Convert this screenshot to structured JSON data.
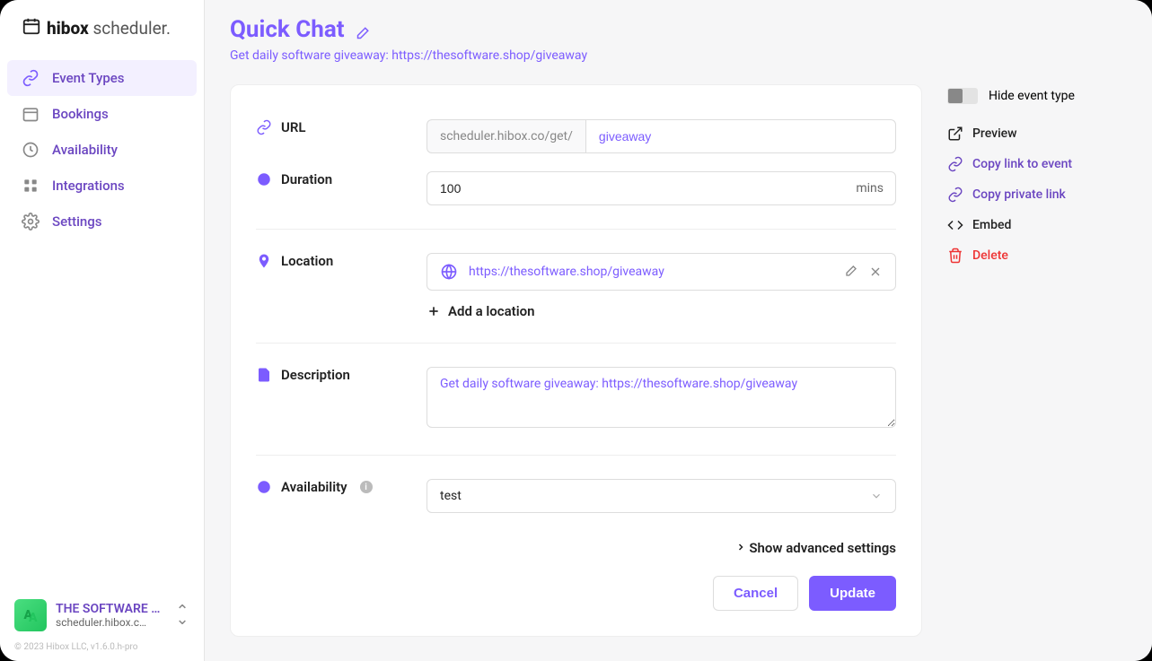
{
  "brand": {
    "bold": "hibox",
    "light": "scheduler."
  },
  "sidebar": {
    "items": [
      {
        "label": "Event Types",
        "icon": "link-icon",
        "active": true
      },
      {
        "label": "Bookings",
        "icon": "calendar-icon",
        "active": false
      },
      {
        "label": "Availability",
        "icon": "clock-icon",
        "active": false
      },
      {
        "label": "Integrations",
        "icon": "grid-icon",
        "active": false
      },
      {
        "label": "Settings",
        "icon": "gear-icon",
        "active": false
      }
    ],
    "user": {
      "name": "THE SOFTWARE …",
      "url": "scheduler.hibox.c…",
      "avatar": "A"
    },
    "copyright": "© 2023 Hibox LLC, v1.6.0.h-pro"
  },
  "header": {
    "title": "Quick Chat",
    "subtitle": "Get daily software giveaway: https://thesoftware.shop/giveaway"
  },
  "form": {
    "url": {
      "label": "URL",
      "prefix": "scheduler.hibox.co/get/",
      "value": "giveaway"
    },
    "duration": {
      "label": "Duration",
      "value": "100",
      "unit": "mins"
    },
    "location": {
      "label": "Location",
      "value": "https://thesoftware.shop/giveaway",
      "add": "Add a location"
    },
    "description": {
      "label": "Description",
      "value": "Get daily software giveaway: https://thesoftware.shop/giveaway"
    },
    "availability": {
      "label": "Availability",
      "value": "test"
    },
    "advanced": "Show advanced settings",
    "cancel": "Cancel",
    "update": "Update"
  },
  "rail": {
    "hide": "Hide event type",
    "preview": "Preview",
    "copy_event": "Copy link to event",
    "copy_private": "Copy private link",
    "embed": "Embed",
    "delete": "Delete"
  }
}
